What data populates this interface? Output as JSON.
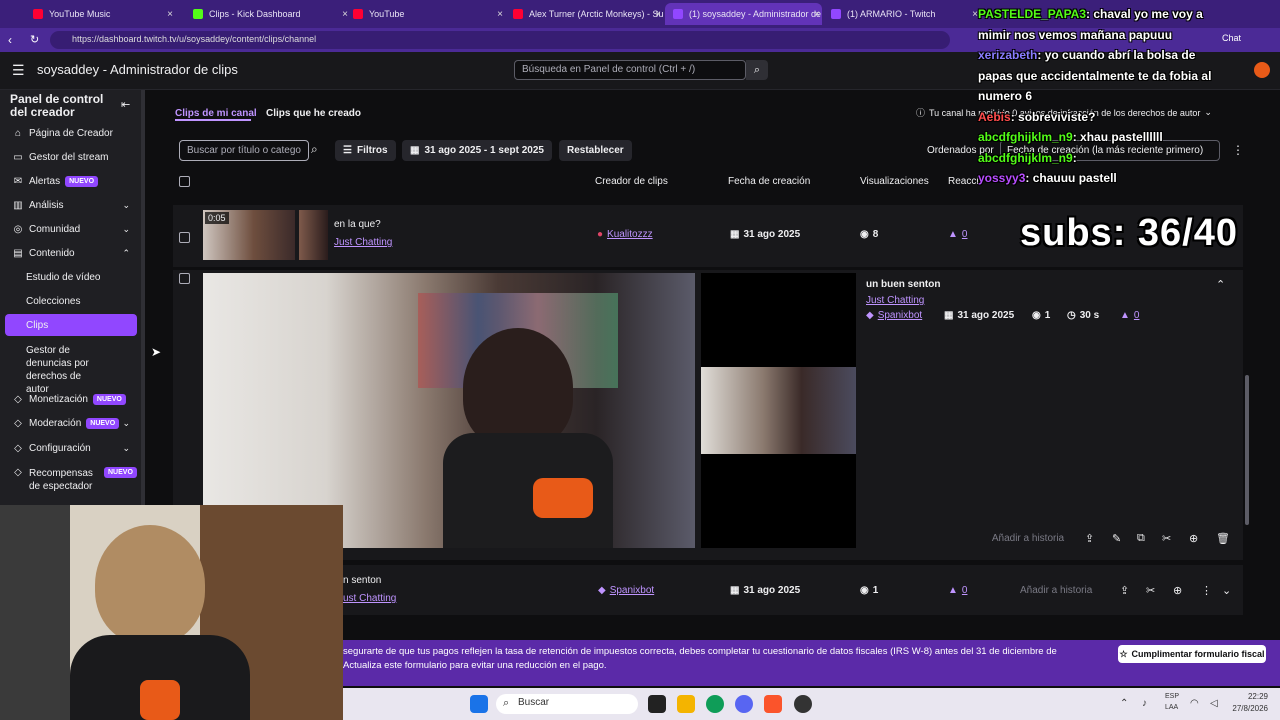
{
  "browser": {
    "tabs": [
      {
        "label": "YouTube Music",
        "color": "#ff0033",
        "active": false
      },
      {
        "label": "Clips - Kick Dashboard",
        "color": "#53fc18",
        "active": false
      },
      {
        "label": "YouTube",
        "color": "#ff0033",
        "active": false
      },
      {
        "label": "Alex Turner (Arctic Monkeys) - Su",
        "color": "#ff0033",
        "active": false
      },
      {
        "label": "(1) soysaddey - Administrador de",
        "color": "#9147ff",
        "active": true
      },
      {
        "label": "(1) ARMARIO - Twitch",
        "color": "#9147ff",
        "active": false
      }
    ],
    "url": "https://dashboard.twitch.tv/u/soysaddey/content/clips/channel"
  },
  "header": {
    "title": "soysaddey - Administrador de clips",
    "search_placeholder": "Búsqueda en Panel de control (Ctrl + /)"
  },
  "sidebar": {
    "title": "Panel de control del creador",
    "items": [
      {
        "label": "Página de Creador",
        "icon": "home-icon"
      },
      {
        "label": "Gestor del stream",
        "icon": "screen-icon"
      },
      {
        "label": "Alertas",
        "badge": "NUEVO",
        "icon": "megaphone-icon"
      },
      {
        "label": "Análisis",
        "icon": "chart-icon"
      },
      {
        "label": "Comunidad",
        "icon": "community-icon"
      },
      {
        "label": "Contenido",
        "icon": "content-icon"
      },
      {
        "label": "Estudio de vídeo"
      },
      {
        "label": "Colecciones"
      },
      {
        "label": "Clips"
      },
      {
        "label": "Gestor de denuncias por derechos de autor"
      },
      {
        "label": "Monetización",
        "badge": "NUEVO"
      },
      {
        "label": "Moderación",
        "badge": "NUEVO"
      },
      {
        "label": "Configuración"
      },
      {
        "label": "Recompensas de espectador",
        "badge": "NUEVO"
      }
    ]
  },
  "main": {
    "tabs": [
      "Clips de mi canal",
      "Clips que he creado"
    ],
    "copyright_notice": "Tu canal ha recibido 0 avisos de infracción de los derechos de autor",
    "filter_placeholder": "Buscar por título o catego",
    "filters_label": "Filtros",
    "date_range": "31 ago 2025 - 1 sept 2025",
    "reset_label": "Restablecer",
    "sort_label": "Ordenados por",
    "sort_value": "Fecha de creación (la más reciente primero)",
    "columns": [
      "Creador de clips",
      "Fecha de creación",
      "Visualizaciones",
      "Reacci"
    ],
    "clips": [
      {
        "title": "en la que?",
        "category": "Just Chatting",
        "duration": "0:05",
        "creator": "Kualitozzz",
        "date": "31 ago 2025",
        "views": "8",
        "likes": "0"
      },
      {
        "title": "un buen senton",
        "category": "Just Chatting",
        "creator": "Spanixbot",
        "date": "31 ago 2025",
        "views": "1",
        "length": "30 s",
        "likes": "0",
        "add_story": "Añadir a historia"
      },
      {
        "title": "n senton",
        "category": "ust Chatting",
        "creator": "Spanixbot",
        "date": "31 ago 2025",
        "views": "1",
        "likes": "0",
        "add_story": "Añadir a historia"
      }
    ]
  },
  "banner": {
    "line1": "segurarte de que tus pagos reflejen la tasa de retención de impuestos correcta, debes completar tu cuestionario de datos fiscales (IRS W-8) antes del 31 de diciembre de",
    "line2": "Actualiza este formulario para evitar una reducción en el pago.",
    "button": "Cumplimentar formulario fiscal"
  },
  "chat": [
    {
      "user": "PASTELDE_PAPA3",
      "text": "chaval yo me voy a",
      "user_color": "#53fc18"
    },
    {
      "user": "",
      "text": "mimir nos vemos mañana papuuu",
      "user_color": "#ffffff"
    },
    {
      "user": "xerizabeth",
      "text": "yo cuando abrí la bolsa de",
      "user_color": "#8a7cff"
    },
    {
      "user": "",
      "text": "papas que accidentalmente te da fobia al",
      "user_color": "#ffffff"
    },
    {
      "user": "",
      "text": "numero 6",
      "user_color": "#ffffff"
    },
    {
      "user": "Aebis",
      "text": "sobreviviste?",
      "user_color": "#ff4d4d"
    },
    {
      "user": "abcdfghijklm_n9",
      "text": "xhau pastellllll",
      "user_color": "#53fc18"
    },
    {
      "user": "abcdfghijklm_n9",
      "text": "",
      "user_color": "#53fc18"
    },
    {
      "user": "yossyy3",
      "text": "chauuu pastell",
      "user_color": "#b84dff"
    }
  ],
  "chat_button": "Chat",
  "subs": "subs: 36/40",
  "taskbar": {
    "search": "Buscar",
    "lang": "ESP",
    "lang2": "LAA",
    "time": "22:29",
    "date": "27/8/2026"
  },
  "colors": {
    "accent": "#9147ff",
    "banner": "#5b2aa8"
  }
}
